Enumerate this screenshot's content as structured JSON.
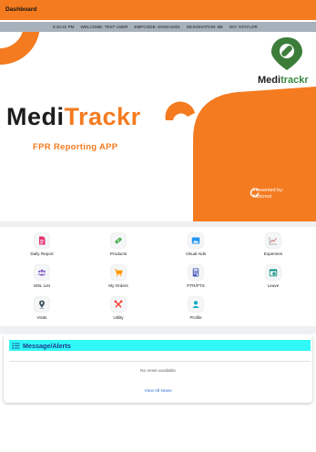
{
  "header": {
    "title": "Dashboard"
  },
  "info": {
    "time": "5:34:41 PM",
    "welcome": "WELCOME: TEST USER",
    "empcode": "EMPCODE: SINGH1001",
    "designation": "DESIGNATION: BE",
    "division": "DIV: STAYLOR"
  },
  "banner": {
    "brand_part1": "Medi",
    "brand_part2": "Trackr",
    "tagline": "FPR Reporting APP",
    "logo_part1": "Medi",
    "logo_part2": "trackr",
    "presented_line1": "Presented by:",
    "presented_line2": "Netcrest"
  },
  "menu": [
    {
      "label": "Daily Report",
      "icon": "document-icon",
      "color": "#e7306f"
    },
    {
      "label": "Products",
      "icon": "pill-icon",
      "color": "#4caf50"
    },
    {
      "label": "Visual Aids",
      "icon": "image-icon",
      "color": "#2196f3"
    },
    {
      "label": "Expenses",
      "icon": "chart-line-icon",
      "color": "#9e9e9e"
    },
    {
      "label": "MSL List",
      "icon": "group-icon",
      "color": "#7e57c2"
    },
    {
      "label": "My Orders",
      "icon": "cart-icon",
      "color": "#ff9800"
    },
    {
      "label": "PTR/PTS",
      "icon": "calculator-icon",
      "color": "#3f51b5"
    },
    {
      "label": "Leave",
      "icon": "calendar-icon",
      "color": "#00897b"
    },
    {
      "label": "Visits",
      "icon": "map-marker-icon",
      "color": "#455a64"
    },
    {
      "label": "Utility",
      "icon": "tools-icon",
      "color": "#f44336"
    },
    {
      "label": "Profile",
      "icon": "person-icon",
      "color": "#00acc1"
    }
  ],
  "messages": {
    "title": "Message/Alerts",
    "empty_text": "No news available",
    "view_all": "View All News"
  },
  "colors": {
    "accent": "#f47b20",
    "cyan": "#2ff8f6",
    "title_blue": "#1a3b8f"
  }
}
